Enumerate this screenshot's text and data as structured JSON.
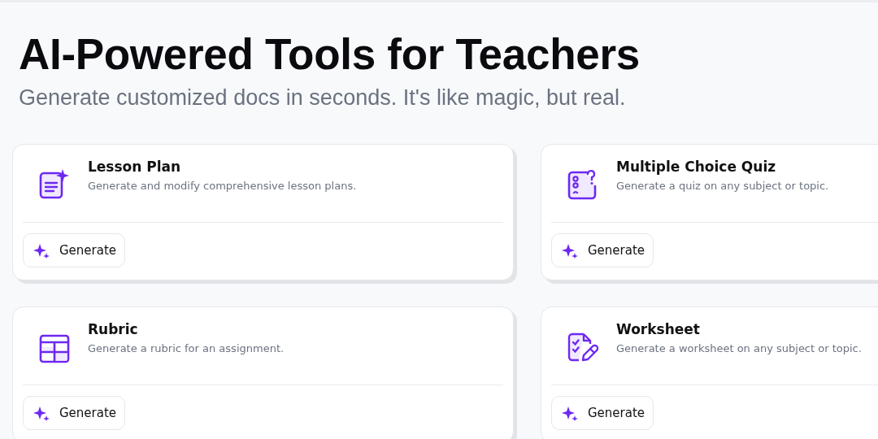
{
  "header": {
    "title": "AI-Powered Tools for Teachers",
    "subtitle": "Generate customized docs in seconds. It's like magic, but real."
  },
  "tools": [
    {
      "kind": "document",
      "title": "Lesson Plan",
      "description": "Generate and modify comprehensive lesson plans.",
      "button": "Generate"
    },
    {
      "kind": "quiz",
      "title": "Multiple Choice Quiz",
      "description": "Generate a quiz on any subject or topic.",
      "button": "Generate"
    },
    {
      "kind": "table",
      "title": "Rubric",
      "description": "Generate a rubric for an assignment.",
      "button": "Generate"
    },
    {
      "kind": "worksheet",
      "title": "Worksheet",
      "description": "Generate a worksheet on any subject or topic.",
      "button": "Generate"
    }
  ]
}
